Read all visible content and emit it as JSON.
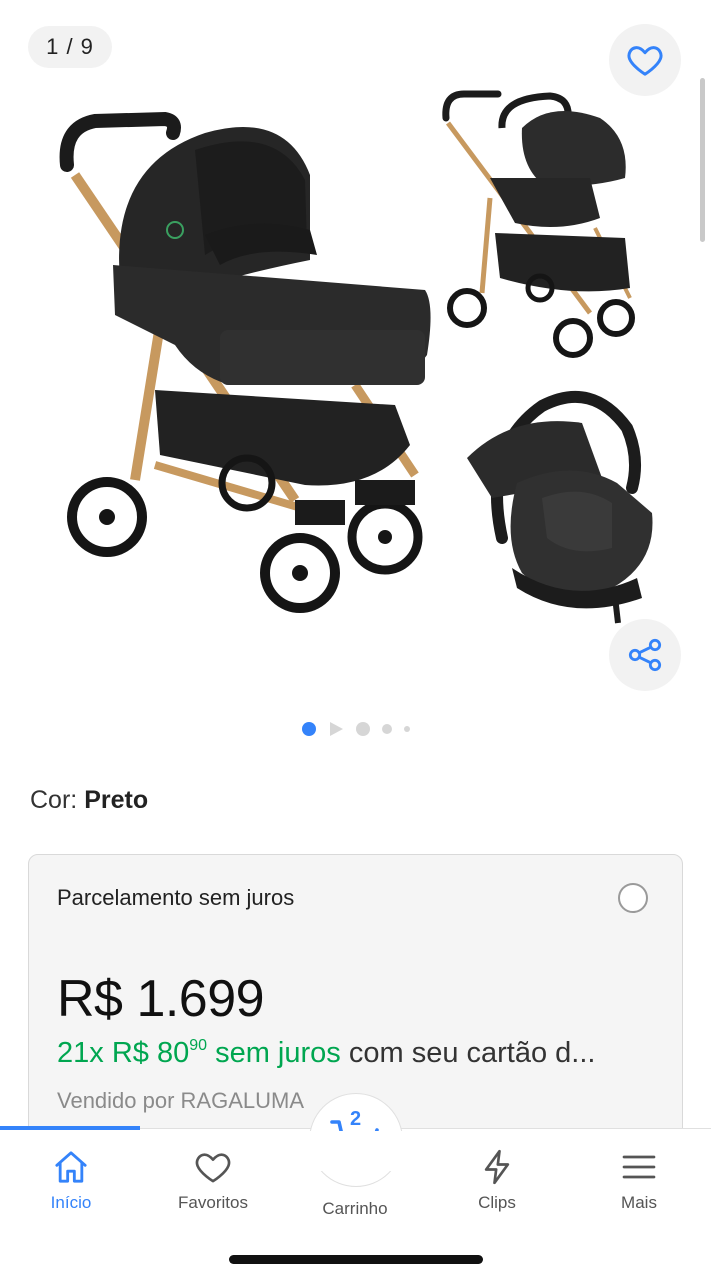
{
  "gallery": {
    "counter": "1 / 9",
    "favorite_icon": "heart-icon",
    "share_icon": "share-icon",
    "images": [
      "stroller-with-bassinet",
      "stroller-with-car-seat",
      "infant-car-seat"
    ],
    "active_dot_color": "#3483fa"
  },
  "product": {
    "color_label": "Cor:",
    "color_value": "Preto"
  },
  "payment": {
    "title": "Parcelamento sem juros",
    "currency": "R$",
    "price": "1.699",
    "installment_count": "21x",
    "installment_currency": "R$",
    "installment_int": "80",
    "installment_cents": "90",
    "installment_no_interest": "sem juros",
    "installment_suffix": "com seu cartão d...",
    "seller": "Vendido por RAGALUMA"
  },
  "nav": {
    "accent": "#3483fa",
    "items": [
      {
        "label": "Início",
        "icon": "home-icon",
        "active": true
      },
      {
        "label": "Favoritos",
        "icon": "heart-icon"
      },
      {
        "label": "Carrinho",
        "icon": "cart-icon",
        "count": "2"
      },
      {
        "label": "Clips",
        "icon": "lightning-icon"
      },
      {
        "label": "Mais",
        "icon": "menu-icon"
      }
    ]
  }
}
